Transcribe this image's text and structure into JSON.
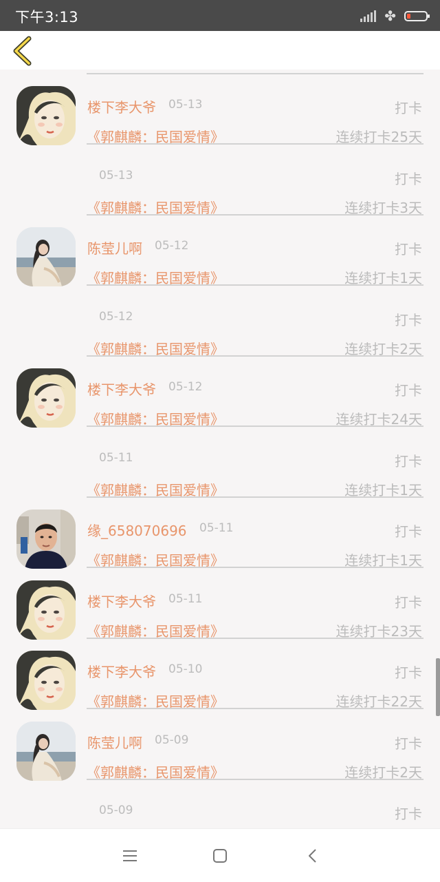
{
  "status": {
    "time": "下午3:13",
    "battery_color": "#ff5a3c"
  },
  "header": {
    "back_icon": "chevron-left-icon",
    "accent": "#f5d84a"
  },
  "colors": {
    "name": "#e8956b",
    "muted": "#bbbbbb"
  },
  "records": [
    {
      "user": "楼下李大爷",
      "avatar": "girl",
      "date": "05-13",
      "action": "打卡",
      "book": "《郭麒麟：民国爱情》",
      "streak": "连续打卡25天"
    },
    {
      "user": "",
      "avatar": "",
      "date": "05-13",
      "action": "打卡",
      "book": "《郭麒麟：民国爱情》",
      "streak": "连续打卡3天"
    },
    {
      "user": "陈莹儿啊",
      "avatar": "beach",
      "date": "05-12",
      "action": "打卡",
      "book": "《郭麒麟：民国爱情》",
      "streak": "连续打卡1天"
    },
    {
      "user": "",
      "avatar": "",
      "date": "05-12",
      "action": "打卡",
      "book": "《郭麒麟：民国爱情》",
      "streak": "连续打卡2天"
    },
    {
      "user": "楼下李大爷",
      "avatar": "girl",
      "date": "05-12",
      "action": "打卡",
      "book": "《郭麒麟：民国爱情》",
      "streak": "连续打卡24天"
    },
    {
      "user": "",
      "avatar": "",
      "date": "05-11",
      "action": "打卡",
      "book": "《郭麒麟：民国爱情》",
      "streak": "连续打卡1天"
    },
    {
      "user": "缘_658070696",
      "avatar": "man",
      "date": "05-11",
      "action": "打卡",
      "book": "《郭麒麟：民国爱情》",
      "streak": "连续打卡1天"
    },
    {
      "user": "楼下李大爷",
      "avatar": "girl",
      "date": "05-11",
      "action": "打卡",
      "book": "《郭麒麟：民国爱情》",
      "streak": "连续打卡23天"
    },
    {
      "user": "楼下李大爷",
      "avatar": "girl",
      "date": "05-10",
      "action": "打卡",
      "book": "《郭麒麟：民国爱情》",
      "streak": "连续打卡22天"
    },
    {
      "user": "陈莹儿啊",
      "avatar": "beach",
      "date": "05-09",
      "action": "打卡",
      "book": "《郭麒麟：民国爱情》",
      "streak": "连续打卡2天"
    },
    {
      "user": "",
      "avatar": "",
      "date": "05-09",
      "action": "打卡",
      "book": "",
      "streak": ""
    }
  ],
  "navbar": {
    "menu_icon": "menu-icon",
    "home_icon": "home-square-icon",
    "back_icon": "back-triangle-icon"
  }
}
